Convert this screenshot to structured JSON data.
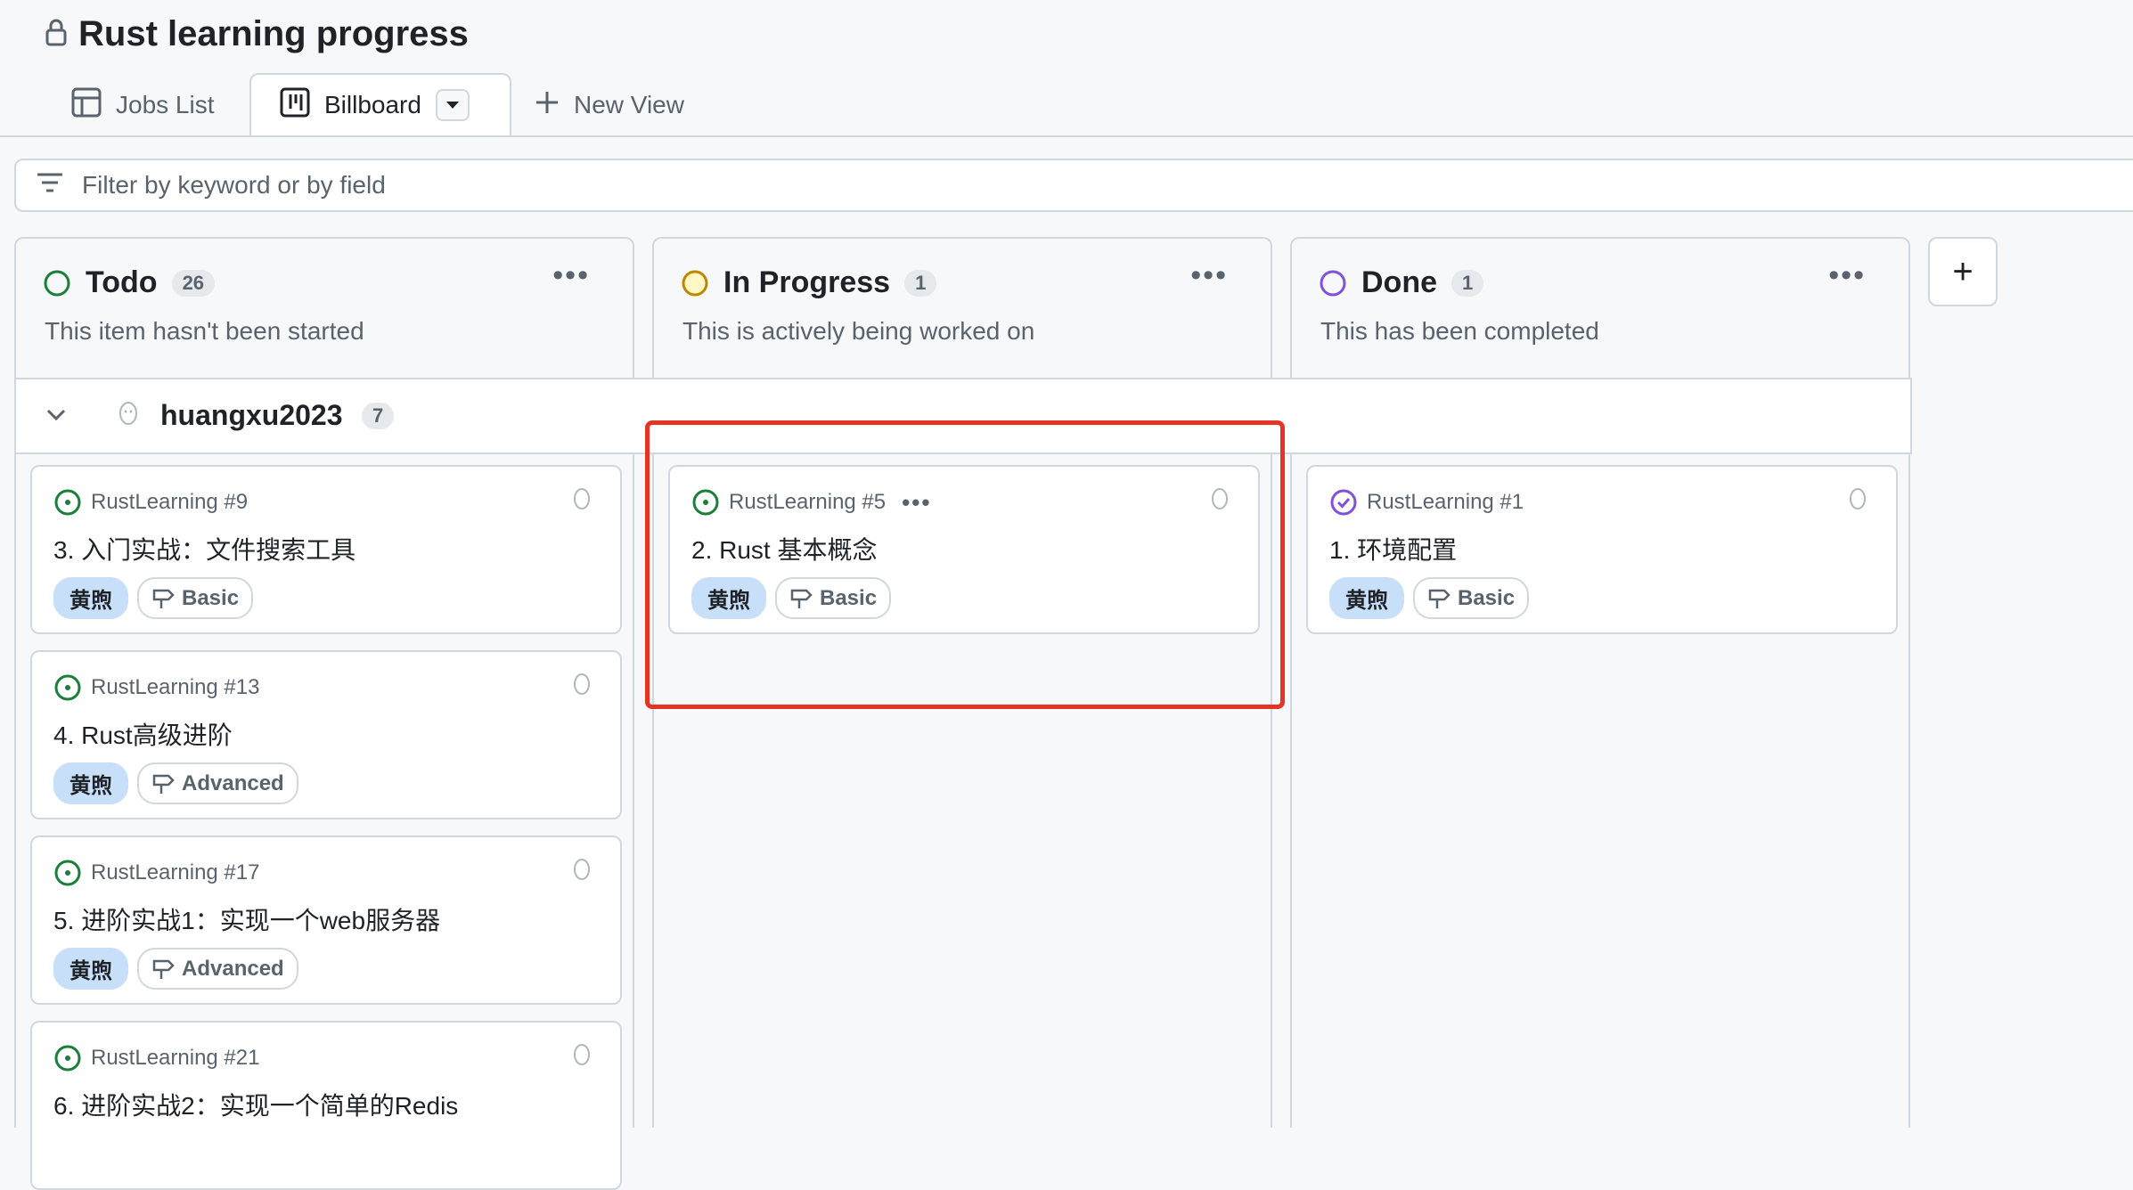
{
  "project": {
    "title": "Rust learning progress"
  },
  "tabs": [
    {
      "label": "Jobs List"
    },
    {
      "label": "Billboard"
    },
    {
      "label": "New View"
    }
  ],
  "filter": {
    "placeholder": "Filter by keyword or by field"
  },
  "columns": [
    {
      "name": "Todo",
      "count": "26",
      "description": "This item hasn't been started",
      "color": "#1a7f37"
    },
    {
      "name": "In Progress",
      "count": "1",
      "description": "This is actively being worked on",
      "color": "#bf8700"
    },
    {
      "name": "Done",
      "count": "1",
      "description": "This has been completed",
      "color": "#8250df"
    }
  ],
  "group": {
    "name": "huangxu2023",
    "count": "7"
  },
  "cards": {
    "todo": [
      {
        "ref": "RustLearning #9",
        "title": "3. 入门实战：文件搜索工具",
        "assignee": "黄煦",
        "milestone": "Basic"
      },
      {
        "ref": "RustLearning #13",
        "title": "4. Rust高级进阶",
        "assignee": "黄煦",
        "milestone": "Advanced"
      },
      {
        "ref": "RustLearning #17",
        "title": "5. 进阶实战1：实现一个web服务器",
        "assignee": "黄煦",
        "milestone": "Advanced"
      },
      {
        "ref": "RustLearning #21",
        "title": "6. 进阶实战2：实现一个简单的Redis"
      }
    ],
    "in_progress": [
      {
        "ref": "RustLearning #5",
        "title": "2. Rust 基本概念",
        "assignee": "黄煦",
        "milestone": "Basic"
      }
    ],
    "done": [
      {
        "ref": "RustLearning #1",
        "title": "1. 环境配置",
        "assignee": "黄煦",
        "milestone": "Basic"
      }
    ]
  },
  "colors": {
    "accent_highlight": "#e53423",
    "open_green": "#1a7f37",
    "done_purple": "#8250df",
    "label_blue": "#c8dffa"
  }
}
